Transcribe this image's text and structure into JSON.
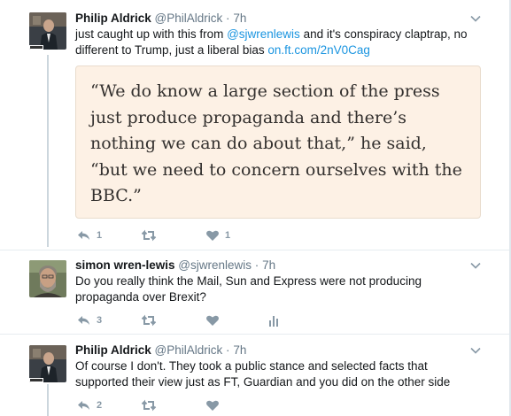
{
  "tweets": [
    {
      "fullname": "Philip Aldrick",
      "username": "@PhilAldrick",
      "time": "7h",
      "lines": [
        [
          {
            "t": "just caught up with this from ",
            "link": false
          },
          {
            "t": "@sjwrenlewis",
            "link": true
          },
          {
            "t": " and it's conspiracy claptrap, no",
            "link": false
          }
        ],
        [
          {
            "t": "different to Trump, just a liberal bias ",
            "link": false
          },
          {
            "t": "on.ft.com/2nV0Cag",
            "link": true
          }
        ]
      ],
      "quote": [
        "“We do know a large section of the press",
        "just produce propaganda and there’s",
        "nothing we can do about that,” he said,",
        "“but we need to concern ourselves with the",
        "BBC.”"
      ],
      "reply_count": "1",
      "retweet_count": "",
      "like_count": "1"
    },
    {
      "fullname": "simon wren-lewis",
      "username": "@sjwrenlewis",
      "time": "7h",
      "lines": [
        [
          {
            "t": "Do you really think the Mail, Sun and Express were not producing",
            "link": false
          }
        ],
        [
          {
            "t": "propaganda over Brexit?",
            "link": false
          }
        ]
      ],
      "reply_count": "3",
      "retweet_count": "",
      "like_count": ""
    },
    {
      "fullname": "Philip Aldrick",
      "username": "@PhilAldrick",
      "time": "7h",
      "lines": [
        [
          {
            "t": "Of course I don't. They took a public stance and selected facts that",
            "link": false
          }
        ],
        [
          {
            "t": "supported their view just as FT, Guardian and you did on the other side",
            "link": false
          }
        ]
      ],
      "reply_count": "2",
      "retweet_count": "",
      "like_count": ""
    }
  ],
  "dot": "·",
  "colors": {
    "link": "#1b95e0",
    "muted": "#657786",
    "action": "#8899a6",
    "quote_bg": "#fdf1e5"
  },
  "icons": [
    "reply-icon",
    "retweet-icon",
    "like-icon",
    "analytics-icon",
    "chevron-down-icon"
  ]
}
